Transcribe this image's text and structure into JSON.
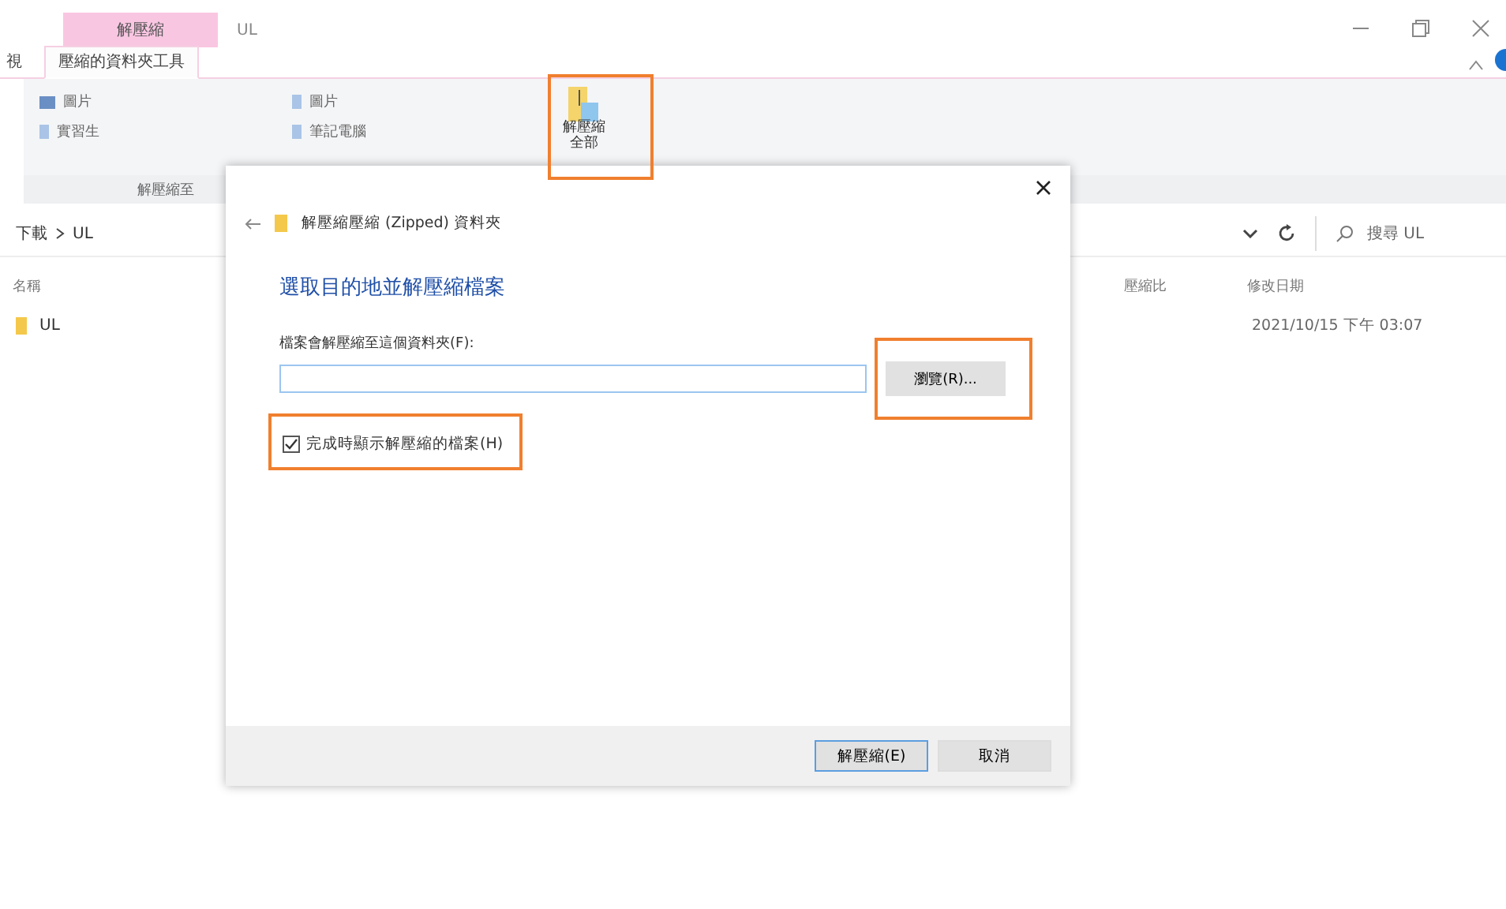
{
  "window": {
    "title": "UL",
    "context_tab_group": "解壓縮"
  },
  "tabs": [
    {
      "label": "視",
      "selected": false
    },
    {
      "label": "壓縮的資料夾工具",
      "selected": true
    }
  ],
  "ribbon": {
    "column_1": [
      "圖片",
      "實習生"
    ],
    "column_2": [
      "圖片",
      "筆記電腦"
    ],
    "extract_all_button": "解壓縮全部",
    "section_label": "解壓縮至"
  },
  "address_bar": {
    "path": [
      "下載",
      "UL"
    ]
  },
  "search": {
    "placeholder": "搜尋 UL"
  },
  "table": {
    "columns": [
      "名稱",
      "壓縮比",
      "修改日期"
    ],
    "rows": [
      {
        "name": "UL",
        "modified": "2021/10/15 下午 03:07"
      }
    ]
  },
  "dialog": {
    "header": "解壓縮壓縮 (Zipped) 資料夾",
    "heading": "選取目的地並解壓縮檔案",
    "field_label": "檔案會解壓縮至這個資料夾(F):",
    "browse_button": "瀏覽(R)...",
    "show_files": {
      "label": "完成時顯示解壓縮的檔案(H)",
      "checked": true
    },
    "buttons": [
      {
        "label": "解壓縮(E)",
        "default": true
      },
      {
        "label": "取消",
        "default": false
      }
    ]
  }
}
